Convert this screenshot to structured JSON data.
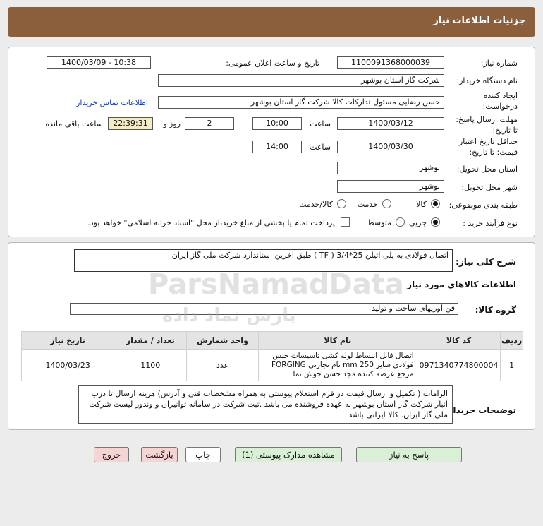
{
  "header": {
    "title": "جزئیات اطلاعات نیاز"
  },
  "form": {
    "need_number_label": "شماره نیاز:",
    "need_number": "1100091368000039",
    "announce_label": "تاریخ و ساعت اعلان عمومی:",
    "announce_value": "1400/03/09 - 10:38",
    "buyer_org_label": "نام دستگاه خریدار:",
    "buyer_org": "شرکت گاز استان بوشهر",
    "creator_label_1": "ایجاد کننده",
    "creator_label_2": "درخواست:",
    "creator": "حسن رضایی مسئول تدارکات کالا شرکت گاز استان بوشهر",
    "contact_link": "اطلاعات تماس خریدار",
    "reply_label_1": "مهلت ارسال پاسخ:",
    "reply_label_2": "تا تاریخ:",
    "reply_date": "1400/03/12",
    "time_label": "ساعت",
    "reply_time": "10:00",
    "days_value": "2",
    "days_label": "روز و",
    "remaining_time": "22:39:31",
    "remaining_label": "ساعت باقی مانده",
    "validity_label_1": "حداقل تاریخ اعتبار",
    "validity_label_2": "قیمت: تا تاریخ:",
    "validity_date": "1400/03/30",
    "validity_time": "14:00",
    "province_label": "استان محل تحویل:",
    "province": "بوشهر",
    "city_label": "شهر محل تحویل:",
    "city": "بوشهر",
    "category_label": "طبقه بندی موضوعی:",
    "category_options": [
      "کالا",
      "خدمت",
      "کالا/خدمت"
    ],
    "category_selected": "کالا",
    "process_label": "نوع فرآیند خرید :",
    "process_options": [
      "جزیی",
      "متوسط"
    ],
    "process_selected": "جزیی",
    "payment_note": "پرداخت تمام یا بخشی از مبلغ خرید،از محل \"اسناد خزانه اسلامی\" خواهد بود."
  },
  "details": {
    "description_label": "شرح کلی نیاز:",
    "description": "اتصال فولادی به پلی اتیلن 25*3/4 ( TF ) طبق آخرین استاندارد شرکت ملی گاز ایران",
    "goods_info_label": "اطلاعات کالاهای مورد نیاز",
    "group_label": "گروه کالا:",
    "group_value": "فن آوریهای ساخت و تولید",
    "table_headers": [
      "ردیف",
      "کد کالا",
      "نام کالا",
      "واحد شمارش",
      "تعداد / مقدار",
      "تاریخ نیاز"
    ],
    "table_rows": [
      {
        "row": "1",
        "code": "0971340774800004",
        "name": "اتصال قابل انبساط لوله کشی تاسیسات جنس فولادی سایز 250 mm نام تجارتی FORGING مرجع عرضه کننده مجد حسن خوش نما",
        "unit": "عدد",
        "qty": "1100",
        "date": "1400/03/23"
      }
    ],
    "buyer_notes_label": "توضیحات خریدار:",
    "buyer_notes": "الزامات ( تکمیل و ارسال قیمت در فرم استعلام پیوستی به همراه مشخصات فنی و آدرس) هزینه ارسال تا درب انبار شرکت گاز استان بوشهر به عهده فروشنده می باشد .ثبت شرکت در سامانه توانیران و وندور لیست شرکت ملی گاز ایران. کالا ایرانی باشد"
  },
  "buttons": {
    "reply": "پاسخ به نیاز",
    "attachments": "مشاهده مدارک پیوستی (1)",
    "print": "چاپ",
    "back": "بازگشت",
    "exit": "خروج"
  },
  "watermark": {
    "line1": "ParsNamadData",
    "line2": "پارس نماد داده"
  },
  "colors": {
    "header": "#8b5e3c",
    "highlight": "#f3ecc6",
    "green_button": "#d9f0d6",
    "pink_button": "#f7d4d4",
    "link": "#1a3fb8"
  }
}
